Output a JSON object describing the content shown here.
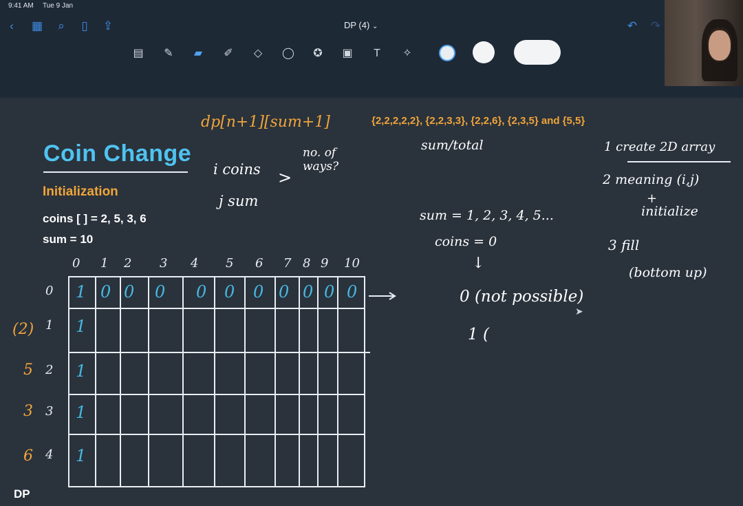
{
  "status": {
    "time": "9:41 AM",
    "date": "Tue 9 Jan"
  },
  "nav": {
    "doc_title": "DP (4)"
  },
  "slide": {
    "title": "Coin Change",
    "subtitle": "Initialization",
    "coins_line": "coins [ ] = 2, 5, 3, 6",
    "sum_line": "sum = 10",
    "examples": "{2,2,2,2,2}, {2,2,3,3}, {2,2,6}, {2,3,5} and {5,5}",
    "footer": "DP"
  },
  "notes": {
    "dp_formula": "dp[n+1][sum+1]",
    "i_coins": "i coins",
    "j_sum": "j sum",
    "no_of_ways": "no. of ways?",
    "sum_total": "sum/total",
    "sum_seq": "sum = 1, 2, 3, 4, 5...",
    "coins_zero": "coins = 0",
    "zero_not_possible": "0 (not possible)",
    "one_paren": "1 (",
    "step1": "1 create 2D array",
    "step2": "2 meaning (i,j)",
    "plus": "+",
    "initialize": "initialize",
    "step3": "3 fill",
    "bottom_up": "(bottom up)"
  },
  "grid": {
    "col_headers": [
      "0",
      "1",
      "2",
      "3",
      "4",
      "5",
      "6",
      "7",
      "8",
      "9",
      "10"
    ],
    "row_headers": [
      "0",
      "1",
      "2",
      "3",
      "4"
    ],
    "coin_labels": [
      "(2)",
      "5",
      "3",
      "6"
    ],
    "row0": [
      "1",
      "0",
      "0",
      "0",
      "0",
      "0",
      "0",
      "0",
      "0",
      "0",
      "0"
    ],
    "col0": [
      "1",
      "1",
      "1",
      "1"
    ]
  },
  "colors": {
    "accent_cyan": "#47b8e0",
    "accent_orange": "#f0a53a",
    "board": "#2a323c",
    "chrome": "#1e2936"
  }
}
